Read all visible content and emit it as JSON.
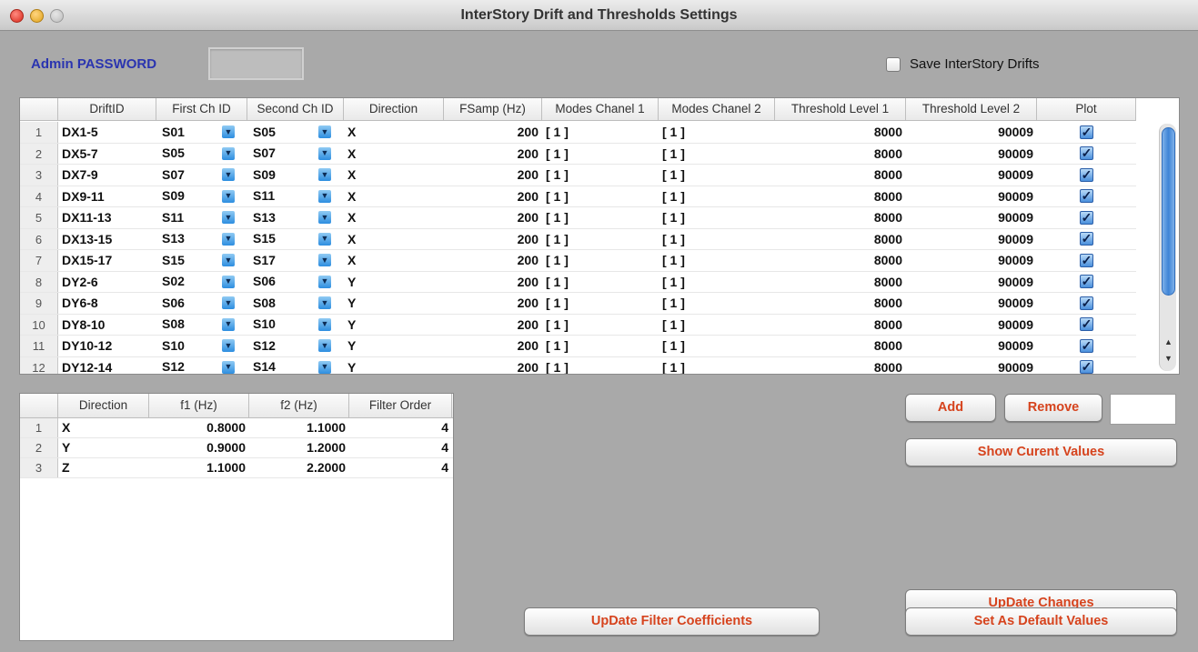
{
  "window": {
    "title": "InterStory Drift and Thresholds Settings"
  },
  "admin": {
    "label": "Admin PASSWORD",
    "password_value": ""
  },
  "save_drifts": {
    "label": "Save InterStory Drifts",
    "checked": false
  },
  "drift_table": {
    "columns": [
      "DriftID",
      "First Ch ID",
      "Second Ch ID",
      "Direction",
      "FSamp (Hz)",
      "Modes Chanel 1",
      "Modes Chanel 2",
      "Threshold Level 1",
      "Threshold Level 2",
      "Plot"
    ],
    "rows": [
      {
        "n": "1",
        "id": "DX1-5",
        "ch1": "S01",
        "ch2": "S05",
        "dir": "X",
        "fs": "200",
        "m1": "[ 1 ]",
        "m2": "[ 1 ]",
        "t1": "8000",
        "t2": "90009",
        "plot": true
      },
      {
        "n": "2",
        "id": "DX5-7",
        "ch1": "S05",
        "ch2": "S07",
        "dir": "X",
        "fs": "200",
        "m1": "[ 1 ]",
        "m2": "[ 1 ]",
        "t1": "8000",
        "t2": "90009",
        "plot": true
      },
      {
        "n": "3",
        "id": "DX7-9",
        "ch1": "S07",
        "ch2": "S09",
        "dir": "X",
        "fs": "200",
        "m1": "[ 1 ]",
        "m2": "[ 1 ]",
        "t1": "8000",
        "t2": "90009",
        "plot": true
      },
      {
        "n": "4",
        "id": "DX9-11",
        "ch1": "S09",
        "ch2": "S11",
        "dir": "X",
        "fs": "200",
        "m1": "[ 1 ]",
        "m2": "[ 1 ]",
        "t1": "8000",
        "t2": "90009",
        "plot": true
      },
      {
        "n": "5",
        "id": "DX11-13",
        "ch1": "S11",
        "ch2": "S13",
        "dir": "X",
        "fs": "200",
        "m1": "[ 1 ]",
        "m2": "[ 1 ]",
        "t1": "8000",
        "t2": "90009",
        "plot": true
      },
      {
        "n": "6",
        "id": "DX13-15",
        "ch1": "S13",
        "ch2": "S15",
        "dir": "X",
        "fs": "200",
        "m1": "[ 1 ]",
        "m2": "[ 1 ]",
        "t1": "8000",
        "t2": "90009",
        "plot": true
      },
      {
        "n": "7",
        "id": "DX15-17",
        "ch1": "S15",
        "ch2": "S17",
        "dir": "X",
        "fs": "200",
        "m1": "[ 1 ]",
        "m2": "[ 1 ]",
        "t1": "8000",
        "t2": "90009",
        "plot": true
      },
      {
        "n": "8",
        "id": "DY2-6",
        "ch1": "S02",
        "ch2": "S06",
        "dir": "Y",
        "fs": "200",
        "m1": "[ 1 ]",
        "m2": "[ 1 ]",
        "t1": "8000",
        "t2": "90009",
        "plot": true
      },
      {
        "n": "9",
        "id": "DY6-8",
        "ch1": "S06",
        "ch2": "S08",
        "dir": "Y",
        "fs": "200",
        "m1": "[ 1 ]",
        "m2": "[ 1 ]",
        "t1": "8000",
        "t2": "90009",
        "plot": true
      },
      {
        "n": "10",
        "id": "DY8-10",
        "ch1": "S08",
        "ch2": "S10",
        "dir": "Y",
        "fs": "200",
        "m1": "[ 1 ]",
        "m2": "[ 1 ]",
        "t1": "8000",
        "t2": "90009",
        "plot": true
      },
      {
        "n": "11",
        "id": "DY10-12",
        "ch1": "S10",
        "ch2": "S12",
        "dir": "Y",
        "fs": "200",
        "m1": "[ 1 ]",
        "m2": "[ 1 ]",
        "t1": "8000",
        "t2": "90009",
        "plot": true
      },
      {
        "n": "12",
        "id": "DY12-14",
        "ch1": "S12",
        "ch2": "S14",
        "dir": "Y",
        "fs": "200",
        "m1": "[ 1 ]",
        "m2": "[ 1 ]",
        "t1": "8000",
        "t2": "90009",
        "plot": true
      }
    ]
  },
  "filter_table": {
    "columns": [
      "Direction",
      "f1 (Hz)",
      "f2 (Hz)",
      "Filter Order"
    ],
    "rows": [
      {
        "n": "1",
        "dir": "X",
        "f1": "0.8000",
        "f2": "1.1000",
        "order": "4"
      },
      {
        "n": "2",
        "dir": "Y",
        "f1": "0.9000",
        "f2": "1.2000",
        "order": "4"
      },
      {
        "n": "3",
        "dir": "Z",
        "f1": "1.1000",
        "f2": "2.2000",
        "order": "4"
      }
    ]
  },
  "buttons": {
    "add": "Add",
    "remove": "Remove",
    "remove_index_value": "",
    "show_current": "Show Curent Values",
    "update_changes": "UpDate Changes",
    "set_default": "Set As Default Values",
    "update_filter": "UpDate Filter Coefficients"
  },
  "icons": {
    "dropdown": "chevron-down-icon",
    "checkbox_checked": "checkmark-icon",
    "scroll_up": "arrow-up-icon",
    "scroll_down": "arrow-down-icon"
  },
  "colors": {
    "button_text": "#d6431d",
    "admin_label": "#2a34b0",
    "window_bg": "#a9a9a9"
  }
}
